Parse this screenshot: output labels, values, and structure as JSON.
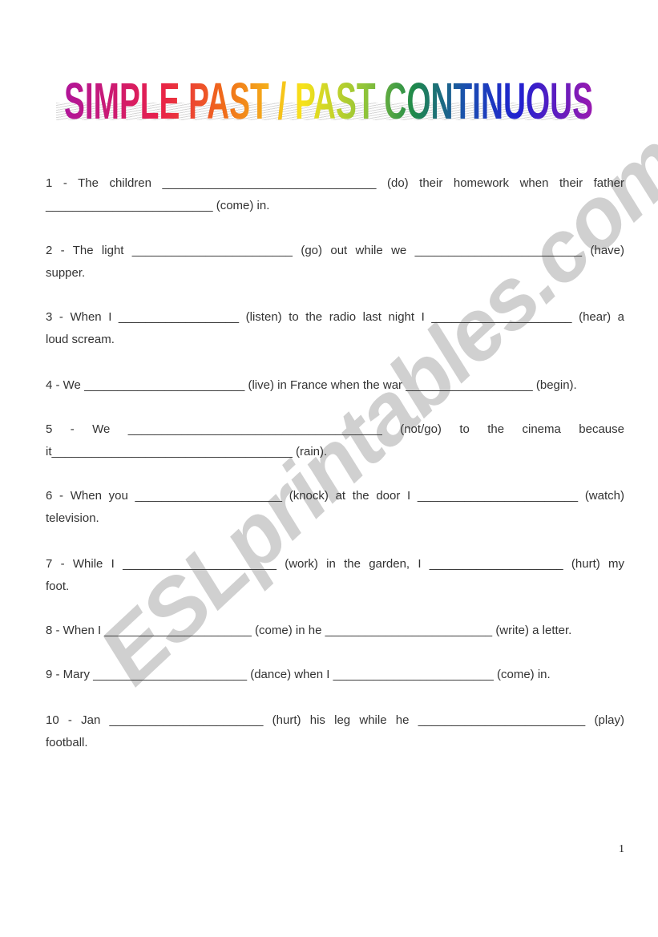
{
  "title": "SIMPLE PAST / PAST CONTINUOUS",
  "watermark": "ESLprintables.com",
  "page_number": "1",
  "questions": [
    {
      "lines": [
        "1 - The children  ________________________________ (do) their homework when their father",
        "_________________________  (come) in."
      ]
    },
    {
      "lines": [
        "2 - The light ________________________  (go)  out while we _________________________ (have)",
        "supper."
      ]
    },
    {
      "lines": [
        "3 - When I __________________  (listen) to the radio last night I _____________________ (hear)  a",
        "loud scream."
      ]
    },
    {
      "lines": [
        "4 - We  ________________________  (live) in France when the war  ___________________ (begin)."
      ]
    },
    {
      "lines": [
        "5  -  We  ______________________________________  (not/go)  to  the  cinema  because",
        "it____________________________________  (rain)."
      ]
    },
    {
      "lines": [
        "6 - When you ______________________ (knock)  at the door I ________________________ (watch)",
        "television."
      ]
    },
    {
      "lines": [
        "7 - While I  _______________________  (work)  in the garden, I  ____________________  (hurt) my",
        "foot."
      ]
    },
    {
      "lines": [
        "8 - When I ______________________  (come)  in he  _________________________  (write) a letter."
      ]
    },
    {
      "lines": [
        "9 - Mary _______________________  (dance) when I ________________________  (come) in."
      ]
    },
    {
      "lines": [
        "10 - Jan  _______________________  (hurt) his leg while he  _________________________  (play)",
        "football."
      ]
    }
  ]
}
